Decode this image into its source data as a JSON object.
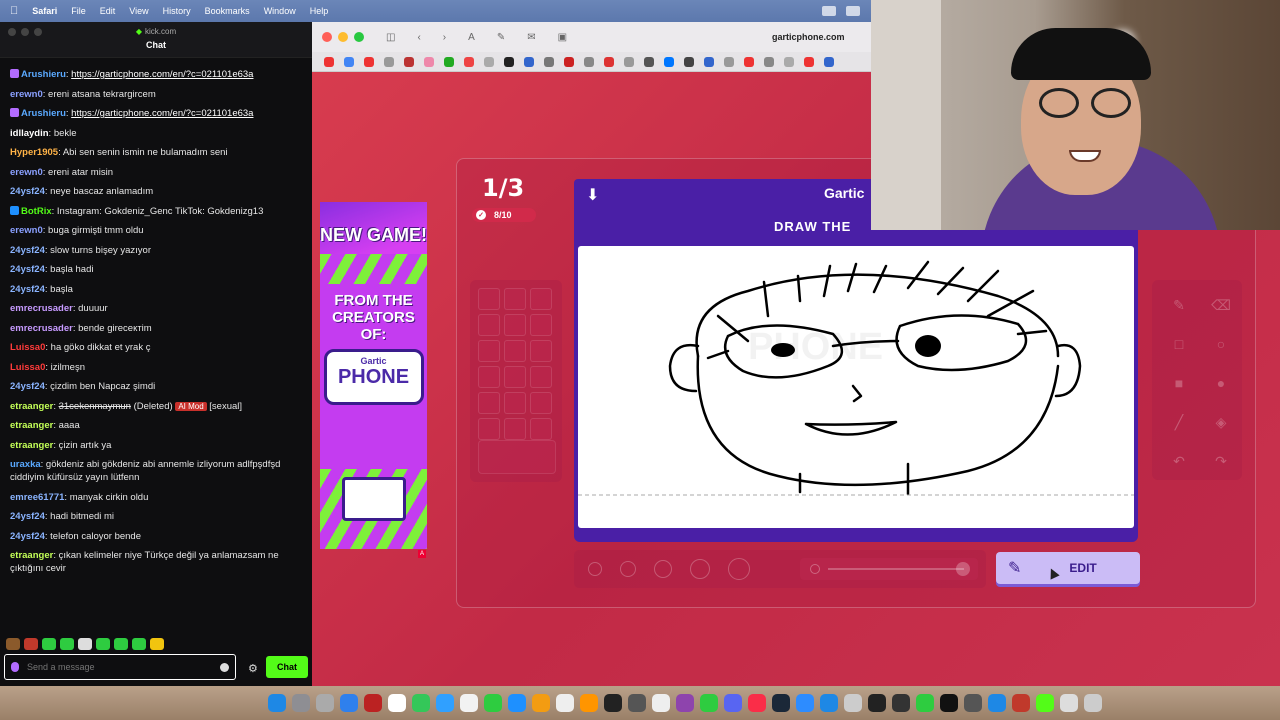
{
  "menubar": {
    "apple": "",
    "items": [
      "Safari",
      "File",
      "Edit",
      "View",
      "History",
      "Bookmarks",
      "Window",
      "Help"
    ]
  },
  "chat_window": {
    "url": "kick.com",
    "title": "Chat",
    "messages": [
      {
        "user": "Arushieru",
        "color": "#5aa9ff",
        "badge": "#b36cff",
        "text": "",
        "link": "https://garticphone.com/en/?c=021101e63a"
      },
      {
        "user": "erewn0",
        "color": "#8aa0ff",
        "text": "ereni atsana tekrargircem"
      },
      {
        "user": "Arushieru",
        "color": "#5aa9ff",
        "badge": "#b36cff",
        "text": "",
        "link": "https://garticphone.com/en/?c=021101e63a"
      },
      {
        "user": "idllaydin",
        "color": "#ffffff",
        "text": "bekle"
      },
      {
        "user": "Hyper1905",
        "color": "#ffb347",
        "text": "Abi sen senin ismin ne bulamadım seni"
      },
      {
        "user": "erewn0",
        "color": "#8aa0ff",
        "text": "ereni atar misin"
      },
      {
        "user": "24ysf24",
        "color": "#8ab4ff",
        "text": "neye bascaz anlamadım"
      },
      {
        "user": "BotRix",
        "color": "#53fc18",
        "badge": "#1e90ff",
        "text": "Instagram: Gokdeniz_Genc TikTok: Gokdenizg13"
      },
      {
        "user": "erewn0",
        "color": "#8aa0ff",
        "text": "buga girmişti tmm oldu"
      },
      {
        "user": "24ysf24",
        "color": "#8ab4ff",
        "text": "slow turns bişey yazıyor"
      },
      {
        "user": "24ysf24",
        "color": "#8ab4ff",
        "text": "başla hadi"
      },
      {
        "user": "24ysf24",
        "color": "#8ab4ff",
        "text": "başla"
      },
      {
        "user": "emrecrusader",
        "color": "#c79bff",
        "text": "duuuur"
      },
      {
        "user": "emrecrusader",
        "color": "#c79bff",
        "text": "bende gireceктim"
      },
      {
        "user": "Luissa0",
        "color": "#ff3b3b",
        "text": "ha göko dikkat et yrak ç"
      },
      {
        "user": "Luissa0",
        "color": "#ff3b3b",
        "text": "izilmeşn"
      },
      {
        "user": "24ysf24",
        "color": "#8ab4ff",
        "text": "çizdim ben Napcaz şimdi"
      },
      {
        "user": "etraanger",
        "color": "#c3ff57",
        "text": "",
        "deleted": "31cekenmaymun",
        "deleted_tag": "(Deleted)",
        "ai": "AI Mod",
        "ai_tag": "[sexual]"
      },
      {
        "user": "etraanger",
        "color": "#c3ff57",
        "text": "aaaa"
      },
      {
        "user": "etraanger",
        "color": "#c3ff57",
        "text": "çizin artık ya"
      },
      {
        "user": "uraxka",
        "color": "#5aa9ff",
        "text": "gökdeniz abi gökdeniz abi annemle izliyorum adlfpşdfşd ciddiyim küfürsüz yayın lütfenn"
      },
      {
        "user": "emree61771",
        "color": "#8ab4ff",
        "text": "manyak cirkin oldu"
      },
      {
        "user": "24ysf24",
        "color": "#8ab4ff",
        "text": "hadi bitmedi mi"
      },
      {
        "user": "24ysf24",
        "color": "#8ab4ff",
        "text": "telefon caloyor bende"
      },
      {
        "user": "etraanger",
        "color": "#c3ff57",
        "text": "çıkan kelimeler niye Türkçe değil ya anlamazsam ne çıktığını cevir"
      }
    ],
    "input_placeholder": "Send a message",
    "send_label": "Chat"
  },
  "browser": {
    "url": "garticphone.com"
  },
  "game": {
    "round_counter": "1/3",
    "progress": "8/10",
    "logo_text": "Gartic",
    "prompt_title": "DRAW THE",
    "watermark": "PHONE",
    "edit_label": "EDIT"
  },
  "ad": {
    "headline": "NEW GAME!",
    "tagline": "FROM THE CREATORS OF:",
    "logo_small": "Gartic",
    "logo_big": "PHONE"
  },
  "colors": {
    "chat_accent": "#53fc18",
    "game_bg": "#c22a46",
    "canvas_frame": "#4a1fa6",
    "edit_button": "#cbbcf6"
  }
}
